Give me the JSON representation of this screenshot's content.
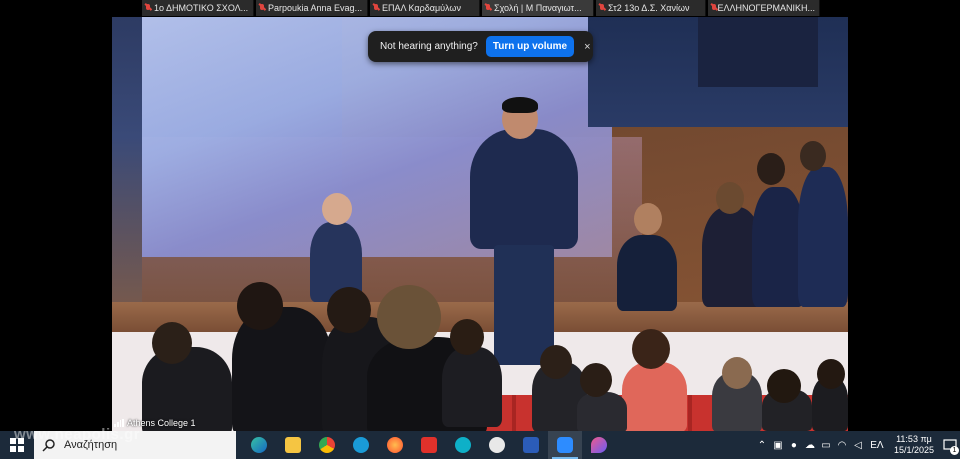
{
  "participants": [
    "1ο ΔΗΜΟΤΙΚΟ ΣΧΟΛ...",
    "Parpoukia Anna Evag...",
    "ΕΠΑΛ Καρδαμύλων",
    "Σχολή | Μ Παναγιωτ...",
    "Στ2 13ο Δ.Σ. Χανίων",
    "ΕΛΛΗΝΟΓΕΡΜΑΝΙΚΗ..."
  ],
  "notification": {
    "message": "Not hearing anything?",
    "button_label": "Turn up volume",
    "close_symbol": "×"
  },
  "video": {
    "room_name": "Athens College 1"
  },
  "watermark": "www.neapolis.gr",
  "taskbar": {
    "search_placeholder": "Αναζήτηση",
    "apps": [
      "Edge",
      "File Explorer",
      "Chrome",
      "Webex",
      "Firefox",
      "Eset",
      "Webex Meetings",
      "Media Player",
      "Word",
      "Zoom",
      "Paint 3D"
    ],
    "language": "ΕΛ",
    "time": "11:53 πμ",
    "date": "15/1/2025",
    "notification_count": "1"
  }
}
